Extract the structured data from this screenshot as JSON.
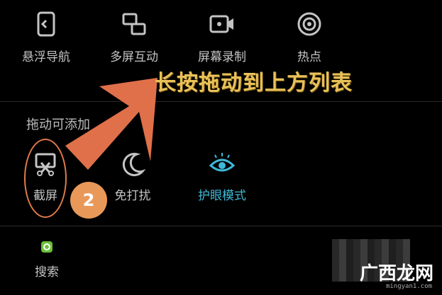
{
  "quick_settings": [
    {
      "label": "悬浮导航",
      "icon": "floating-nav-icon"
    },
    {
      "label": "多屏互动",
      "icon": "multi-screen-icon"
    },
    {
      "label": "屏幕录制",
      "icon": "screen-record-icon"
    },
    {
      "label": "热点",
      "icon": "hotspot-icon"
    }
  ],
  "add_section": {
    "title": "拖动可添加",
    "items": [
      {
        "label": "截屏",
        "icon": "screenshot-icon"
      },
      {
        "label": "免打扰",
        "icon": "moon-icon"
      },
      {
        "label": "护眼模式",
        "icon": "eye-icon",
        "color": "#3fb9d8"
      }
    ]
  },
  "search": {
    "label": "搜索",
    "icon": "search-app-icon"
  },
  "annotation": {
    "text": "长按拖动到上方列表",
    "step": "2",
    "arrow_color": "#e0704a",
    "text_color": "#e8c158"
  },
  "watermark": {
    "logo": "广西龙网",
    "url": "mingyan1.com"
  }
}
